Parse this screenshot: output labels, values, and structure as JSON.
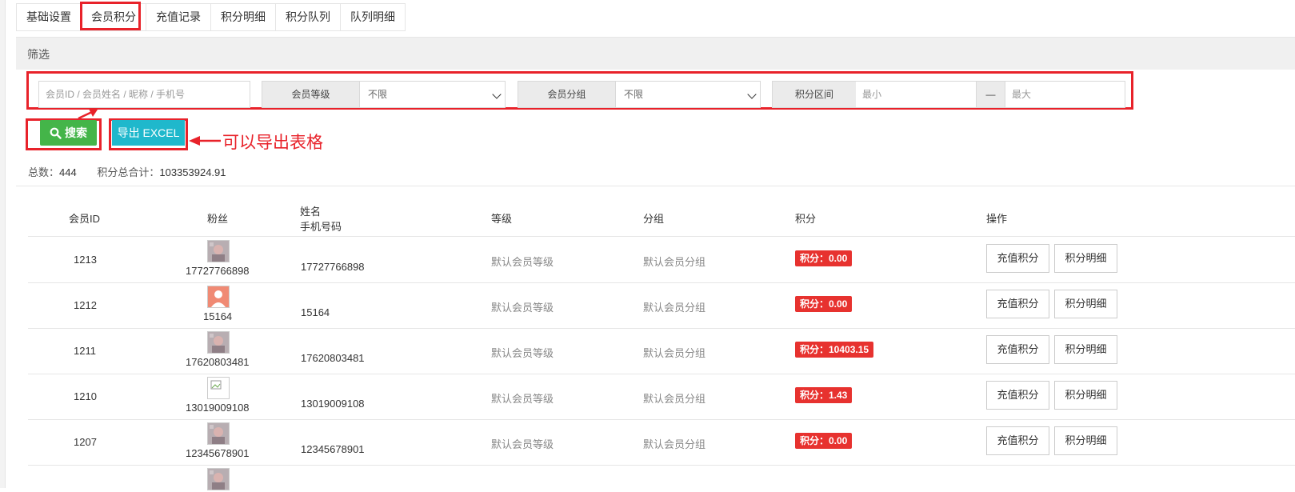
{
  "tabs": [
    "基础设置",
    "会员积分",
    "充值记录",
    "积分明细",
    "积分队列",
    "队列明细"
  ],
  "filter": {
    "title": "筛选",
    "keyword_placeholder": "会员ID / 会员姓名 / 昵称 / 手机号",
    "level_label": "会员等级",
    "level_value": "不限",
    "group_label": "会员分组",
    "group_value": "不限",
    "range_label": "积分区间",
    "min_placeholder": "最小",
    "range_sep": "—",
    "max_placeholder": "最大"
  },
  "buttons": {
    "search": "搜索",
    "export": "导出 EXCEL"
  },
  "annotation": "可以导出表格",
  "summary": {
    "total_label": "总数：",
    "total_value": "444",
    "sum_label": "积分总合计：",
    "sum_value": "103353924.91"
  },
  "table": {
    "headers": {
      "id": "会员ID",
      "fans": "粉丝",
      "name": "姓名",
      "phone": "手机号码",
      "level": "等级",
      "group": "分组",
      "points": "积分",
      "ops": "操作"
    },
    "rows": [
      {
        "id": "1213",
        "fan": "17727766898",
        "phone": "17727766898",
        "level": "默认会员等级",
        "group": "默认会员分组",
        "points": "积分：0.00",
        "avatar": "photo"
      },
      {
        "id": "1212",
        "fan": "15164",
        "phone": "15164",
        "level": "默认会员等级",
        "group": "默认会员分组",
        "points": "积分：0.00",
        "avatar": "default"
      },
      {
        "id": "1211",
        "fan": "17620803481",
        "phone": "17620803481",
        "level": "默认会员等级",
        "group": "默认会员分组",
        "points": "积分：10403.15",
        "avatar": "photo"
      },
      {
        "id": "1210",
        "fan": "13019009108",
        "phone": "13019009108",
        "level": "默认会员等级",
        "group": "默认会员分组",
        "points": "积分：1.43",
        "avatar": "broken"
      },
      {
        "id": "1207",
        "fan": "12345678901",
        "phone": "12345678901",
        "level": "默认会员等级",
        "group": "默认会员分组",
        "points": "积分：0.00",
        "avatar": "photo"
      }
    ],
    "op_recharge": "充值积分",
    "op_detail": "积分明细"
  },
  "colors": {
    "accent_red": "#e8222a",
    "search_green": "#44b549",
    "export_cyan": "#1fb8cc",
    "points_red": "#e7322f"
  }
}
